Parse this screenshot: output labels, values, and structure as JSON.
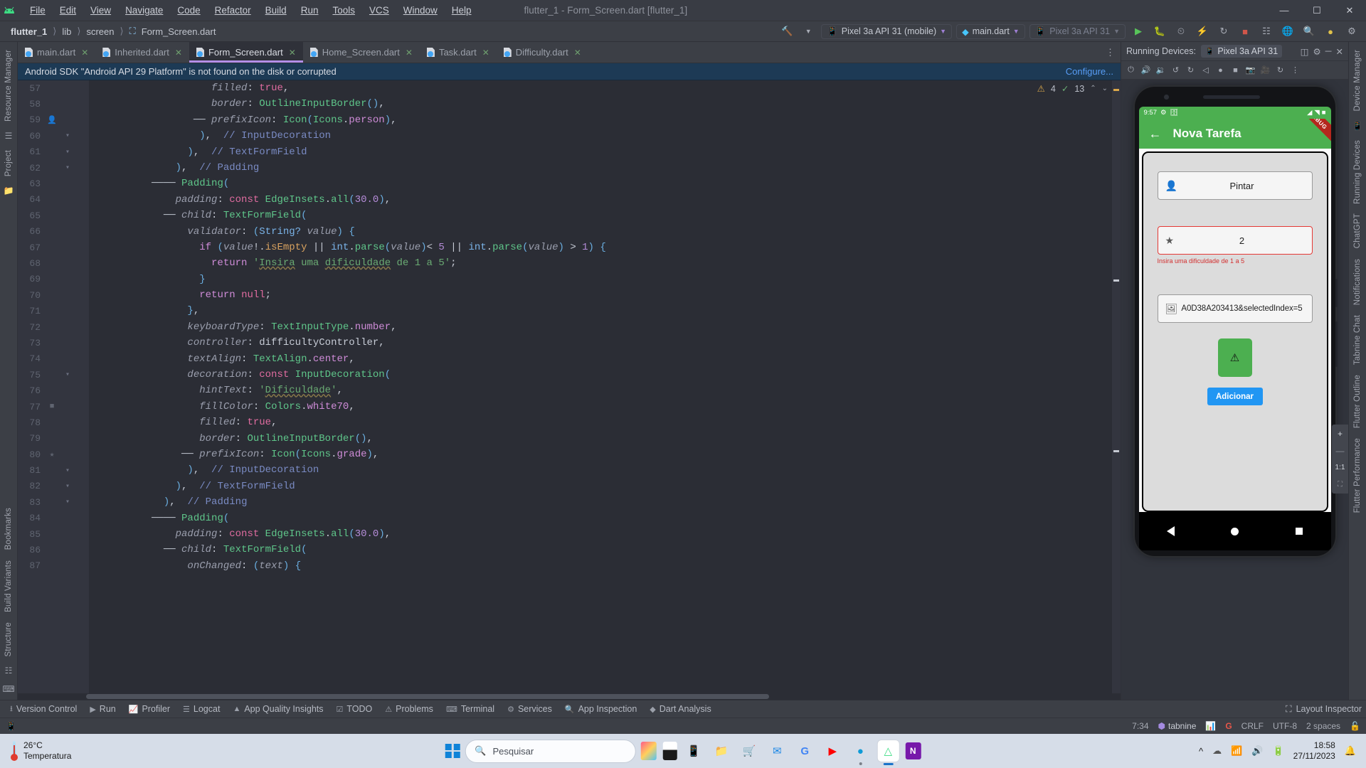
{
  "titlebar": {
    "logo_icon": "android-logo-icon",
    "menu": [
      "File",
      "Edit",
      "View",
      "Navigate",
      "Code",
      "Refactor",
      "Build",
      "Run",
      "Tools",
      "VCS",
      "Window",
      "Help"
    ],
    "window_title": "flutter_1 - Form_Screen.dart [flutter_1]",
    "minimize": "—",
    "maximize": "☐",
    "close": "✕"
  },
  "navbar": {
    "breadcrumbs": [
      "flutter_1",
      "lib",
      "screen",
      "Form_Screen.dart"
    ],
    "device_selector": "Pixel 3a API 31 (mobile)",
    "run_config": "main.dart",
    "device_secondary": "Pixel 3a API 31",
    "icons": [
      "hammer-icon",
      "run-icon",
      "debug-icon",
      "profile-icon",
      "hot-reload-icon",
      "stop-icon",
      "search-everywhere-icon",
      "translate-icon",
      "search-icon",
      "account-icon",
      "settings-icon"
    ]
  },
  "tabs": [
    {
      "label": "main.dart",
      "active": false
    },
    {
      "label": "Inherited.dart",
      "active": false
    },
    {
      "label": "Form_Screen.dart",
      "active": true
    },
    {
      "label": "Home_Screen.dart",
      "active": false
    },
    {
      "label": "Task.dart",
      "active": false
    },
    {
      "label": "Difficulty.dart",
      "active": false
    }
  ],
  "banner": {
    "message": "Android SDK \"Android API 29 Platform\" is not found on the disk or corrupted",
    "action": "Configure..."
  },
  "inspection": {
    "warnings": "4",
    "checks": "13",
    "warning_icon": "warning-triangle-icon",
    "ok_icon": "check-icon",
    "up_icon": "⌃",
    "down_icon": "⌄"
  },
  "left_rail": [
    "Resource Manager",
    "Project",
    "Bookmarks",
    "Build Variants",
    "Structure"
  ],
  "right_rail": [
    "Device Manager",
    "Running Devices",
    "ChatGPT",
    "Notifications",
    "Tabnine Chat",
    "Flutter Outline",
    "Flutter Performance"
  ],
  "editor": {
    "first_line": 57,
    "lines": [
      {
        "n": 57,
        "marker": "",
        "fold": "",
        "html": "                    <span class='c-field'>filled</span><span class='c-op'>:</span> <span class='c-kw2'>true</span><span class='c-op'>,</span>"
      },
      {
        "n": 58,
        "marker": "",
        "fold": "",
        "html": "                    <span class='c-field'>border</span><span class='c-op'>:</span> <span class='c-type'>OutlineInputBorder</span><span class='c-br'>()</span><span class='c-op'>,</span>"
      },
      {
        "n": 59,
        "marker": "person",
        "fold": "",
        "html": "                 ── <span class='c-field'>prefixIcon</span><span class='c-op'>:</span> <span class='c-type'>Icon</span><span class='c-br'>(</span><span class='c-type'>Icons</span><span class='c-op'>.</span><span class='c-kw'>person</span><span class='c-br'>)</span><span class='c-op'>,</span>"
      },
      {
        "n": 60,
        "marker": "",
        "fold": "fold",
        "html": "                  <span class='c-br'>)</span><span class='c-op'>,</span>  <span class='c-cmt'>// InputDecoration</span>"
      },
      {
        "n": 61,
        "marker": "",
        "fold": "fold",
        "html": "                <span class='c-br'>)</span><span class='c-op'>,</span>  <span class='c-cmt'>// TextFormField</span>"
      },
      {
        "n": 62,
        "marker": "",
        "fold": "fold",
        "html": "              <span class='c-br'>)</span><span class='c-op'>,</span>  <span class='c-cmt'>// Padding</span>"
      },
      {
        "n": 63,
        "marker": "",
        "fold": "",
        "html": "          ──── <span class='c-type'>Padding</span><span class='c-br'>(</span>"
      },
      {
        "n": 64,
        "marker": "",
        "fold": "",
        "html": "              <span class='c-field'>padding</span><span class='c-op'>:</span> <span class='c-kw2'>const</span> <span class='c-type'>EdgeInsets</span><span class='c-op'>.</span><span class='c-cls'>all</span><span class='c-br'>(</span><span class='c-num'>30.0</span><span class='c-br'>)</span><span class='c-op'>,</span>"
      },
      {
        "n": 65,
        "marker": "",
        "fold": "",
        "html": "            ── <span class='c-field'>child</span><span class='c-op'>:</span> <span class='c-type'>TextFormField</span><span class='c-br'>(</span>"
      },
      {
        "n": 66,
        "marker": "",
        "fold": "",
        "html": "                <span class='c-field'>validator</span><span class='c-op'>:</span> <span class='c-br'>(</span><span class='c-prop'>String?</span> <span class='c-par'>value</span><span class='c-br'>)</span> <span class='c-br'>{</span>"
      },
      {
        "n": 67,
        "marker": "",
        "fold": "",
        "html": "                  <span class='c-ctl'>if</span> <span class='c-br'>(</span><span class='c-par'>value</span><span class='c-op'>!.</span><span class='c-orange'>isEmpty</span> <span class='c-op'>||</span> <span class='c-prop'>int</span><span class='c-op'>.</span><span class='c-cls'>parse</span><span class='c-br'>(</span><span class='c-par'>value</span><span class='c-br'>)</span><span class='c-op'>&lt; </span><span class='c-num'>5</span> <span class='c-op'>||</span> <span class='c-prop'>int</span><span class='c-op'>.</span><span class='c-cls'>parse</span><span class='c-br'>(</span><span class='c-par'>value</span><span class='c-br'>)</span> <span class='c-op'>&gt; </span><span class='c-num'>1</span><span class='c-br'>)</span> <span class='c-br'>{</span>"
      },
      {
        "n": 68,
        "marker": "",
        "fold": "",
        "html": "                    <span class='c-ctl'>return</span> <span class='c-str'>'<span class='ul-err'>Insira</span> uma <span class='ul-err'>dificuldade</span> de 1 a 5'</span><span class='c-op'>;</span>"
      },
      {
        "n": 69,
        "marker": "",
        "fold": "",
        "html": "                  <span class='c-br'>}</span>"
      },
      {
        "n": 70,
        "marker": "",
        "fold": "",
        "html": "                  <span class='c-ctl'>return</span> <span class='c-kw2'>null</span><span class='c-op'>;</span>"
      },
      {
        "n": 71,
        "marker": "",
        "fold": "",
        "html": "                <span class='c-br'>}</span><span class='c-op'>,</span>"
      },
      {
        "n": 72,
        "marker": "",
        "fold": "",
        "html": "                <span class='c-field'>keyboardType</span><span class='c-op'>:</span> <span class='c-type'>TextInputType</span><span class='c-op'>.</span><span class='c-kw'>number</span><span class='c-op'>,</span>"
      },
      {
        "n": 73,
        "marker": "",
        "fold": "",
        "html": "                <span class='c-field'>controller</span><span class='c-op'>:</span> <span class='c-id'>difficultyController</span><span class='c-op'>,</span>"
      },
      {
        "n": 74,
        "marker": "",
        "fold": "",
        "html": "                <span class='c-field'>textAlign</span><span class='c-op'>:</span> <span class='c-type'>TextAlign</span><span class='c-op'>.</span><span class='c-kw'>center</span><span class='c-op'>,</span>"
      },
      {
        "n": 75,
        "marker": "",
        "fold": "fold",
        "html": "                <span class='c-field'>decoration</span><span class='c-op'>:</span> <span class='c-kw2'>const</span> <span class='c-type'>InputDecoration</span><span class='c-br'>(</span>"
      },
      {
        "n": 76,
        "marker": "",
        "fold": "",
        "html": "                  <span class='c-field'>hintText</span><span class='c-op'>:</span> <span class='c-str'>'<span class='ul-err'>Dificuldade</span>'</span><span class='c-op'>,</span>"
      },
      {
        "n": 77,
        "marker": "color",
        "fold": "",
        "html": "                  <span class='c-field'>fillColor</span><span class='c-op'>:</span> <span class='c-type'>Colors</span><span class='c-op'>.</span><span class='c-kw'>white70</span><span class='c-op'>,</span>"
      },
      {
        "n": 78,
        "marker": "",
        "fold": "",
        "html": "                  <span class='c-field'>filled</span><span class='c-op'>:</span> <span class='c-kw2'>true</span><span class='c-op'>,</span>"
      },
      {
        "n": 79,
        "marker": "",
        "fold": "",
        "html": "                  <span class='c-field'>border</span><span class='c-op'>:</span> <span class='c-type'>OutlineInputBorder</span><span class='c-br'>()</span><span class='c-op'>,</span>"
      },
      {
        "n": 80,
        "marker": "star",
        "fold": "",
        "html": "               ── <span class='c-field'>prefixIcon</span><span class='c-op'>:</span> <span class='c-type'>Icon</span><span class='c-br'>(</span><span class='c-type'>Icons</span><span class='c-op'>.</span><span class='c-kw'>grade</span><span class='c-br'>)</span><span class='c-op'>,</span>"
      },
      {
        "n": 81,
        "marker": "",
        "fold": "fold",
        "html": "                <span class='c-br'>)</span><span class='c-op'>,</span>  <span class='c-cmt'>// InputDecoration</span>"
      },
      {
        "n": 82,
        "marker": "",
        "fold": "fold",
        "html": "              <span class='c-br'>)</span><span class='c-op'>,</span>  <span class='c-cmt'>// TextFormField</span>"
      },
      {
        "n": 83,
        "marker": "",
        "fold": "fold",
        "html": "            <span class='c-br'>)</span><span class='c-op'>,</span>  <span class='c-cmt'>// Padding</span>"
      },
      {
        "n": 84,
        "marker": "",
        "fold": "",
        "html": "          ──── <span class='c-type'>Padding</span><span class='c-br'>(</span>"
      },
      {
        "n": 85,
        "marker": "",
        "fold": "",
        "html": "              <span class='c-field'>padding</span><span class='c-op'>:</span> <span class='c-kw2'>const</span> <span class='c-type'>EdgeInsets</span><span class='c-op'>.</span><span class='c-cls'>all</span><span class='c-br'>(</span><span class='c-num'>30.0</span><span class='c-br'>)</span><span class='c-op'>,</span>"
      },
      {
        "n": 86,
        "marker": "",
        "fold": "",
        "html": "            ── <span class='c-field'>child</span><span class='c-op'>:</span> <span class='c-type'>TextFormField</span><span class='c-br'>(</span>"
      },
      {
        "n": 87,
        "marker": "",
        "fold": "",
        "html": "                <span class='c-field'>onChanged</span><span class='c-op'>:</span> <span class='c-br'>(</span><span class='c-par'>text</span><span class='c-br'>)</span> <span class='c-br'>{</span>"
      }
    ]
  },
  "device_panel": {
    "title": "Running Devices:",
    "device": "Pixel 3a API 31",
    "icons": [
      "power-icon",
      "volume-up-icon",
      "volume-down-icon",
      "rotate-left-icon",
      "rotate-right-icon",
      "back-icon",
      "home-icon",
      "overview-icon",
      "screenshot-icon",
      "record-icon",
      "refresh-icon",
      "more-icon"
    ],
    "header_icons": [
      "split-icon",
      "settings-icon",
      "minimize-icon",
      "close-icon"
    ]
  },
  "emulator": {
    "status_time": "9:57",
    "status_icons": [
      "gear-icon",
      "bag-icon",
      "wifi-icon",
      "signal-icon",
      "battery-icon"
    ],
    "debug_ribbon": "DEBUG",
    "back_icon": "arrow-back-icon",
    "app_title": "Nova Tarefa",
    "fields": [
      {
        "icon": "person-icon",
        "value": "Pintar",
        "error": false
      },
      {
        "icon": "star-icon",
        "value": "2",
        "error": true,
        "error_text": "Insira uma dificuldade de 1 a 5"
      },
      {
        "icon": "image-icon",
        "value": "A0D38A203413&selectedIndex=5",
        "error": false
      }
    ],
    "preview_icon": "error-circle-icon",
    "submit_label": "Adicionar",
    "nav": [
      "back-triangle-icon",
      "home-circle-icon",
      "recents-square-icon"
    ],
    "accent_green": "#4caf50",
    "accent_blue": "#2196f3",
    "error_red": "#e53935"
  },
  "zoom_controls": {
    "zoom_in": "+",
    "zoom_out": "—",
    "ratio": "1:1",
    "fit": "fit-screen-icon"
  },
  "bottom_toolwindows": [
    {
      "label": "Version Control",
      "icon": "branch-icon"
    },
    {
      "label": "Run",
      "icon": "run-icon"
    },
    {
      "label": "Profiler",
      "icon": "profiler-icon"
    },
    {
      "label": "Logcat",
      "icon": "logcat-icon"
    },
    {
      "label": "App Quality Insights",
      "icon": "insights-icon"
    },
    {
      "label": "TODO",
      "icon": "todo-icon"
    },
    {
      "label": "Problems",
      "icon": "problems-icon"
    },
    {
      "label": "Terminal",
      "icon": "terminal-icon"
    },
    {
      "label": "Services",
      "icon": "services-icon"
    },
    {
      "label": "App Inspection",
      "icon": "inspection-icon"
    },
    {
      "label": "Dart Analysis",
      "icon": "dart-icon"
    }
  ],
  "layout_inspector": "Layout Inspector",
  "statusbar": {
    "caret": "7:34",
    "tabnine": "tabnine",
    "line_sep": "CRLF",
    "encoding": "UTF-8",
    "indent": "2 spaces",
    "lock_icon": "lock-icon",
    "google_icon": "google-icon",
    "memory_icon": "memory-icon",
    "device_icon": "device-icon"
  },
  "taskbar": {
    "temperature": "26°C",
    "temperature_label": "Temperatura",
    "search_placeholder": "Pesquisar",
    "search_icon": "search-icon",
    "start_icon": "windows-start-icon",
    "apps": [
      "prezi-icon",
      "app-dark-icon",
      "phone-link-icon",
      "file-explorer-icon",
      "microsoft-store-icon",
      "mail-icon",
      "google-icon",
      "youtube-icon",
      "edge-icon",
      "android-studio-icon",
      "onenote-icon"
    ],
    "tray": [
      "chevron-up-icon",
      "onedrive-error-icon",
      "wifi-icon",
      "volume-icon",
      "battery-icon"
    ],
    "time": "18:58",
    "date": "27/11/2023",
    "bell_icon": "notification-bell-icon"
  }
}
